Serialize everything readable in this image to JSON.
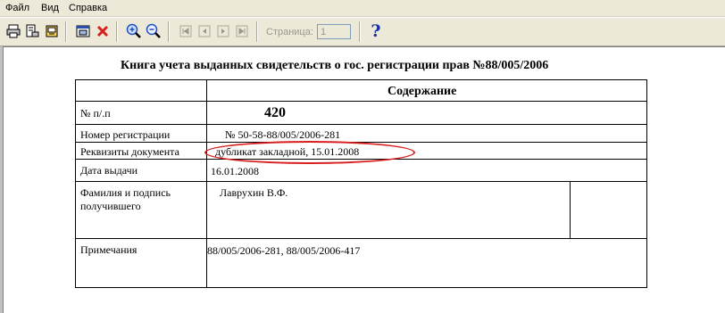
{
  "menu": {
    "file": "Файл",
    "view": "Вид",
    "help": "Справка"
  },
  "toolbar": {
    "icons": [
      "printer-icon",
      "page-setup-icon",
      "export-icon",
      "fit-page-icon",
      "close-icon",
      "zoom-in-icon",
      "zoom-out-icon",
      "first-page-icon",
      "prev-page-icon",
      "next-page-icon",
      "last-page-icon",
      "help-icon"
    ],
    "page_label": "Страница:",
    "page_value": "1",
    "help_glyph": "?"
  },
  "colors": {
    "accent_red": "#d81e1e",
    "help_blue": "#1a2fa6",
    "zoom_blue": "#1f4fbf"
  },
  "report": {
    "title": "Книга учета выданных свидетельств о гос. регистрации прав  №88/005/2006",
    "header": "Содержание",
    "rows": [
      {
        "label": "№ п/.п",
        "value": "420"
      },
      {
        "label": "Номер регистрации",
        "value": "№ 50-58-88/005/2006-281"
      },
      {
        "label": "Реквизиты документа",
        "value": "дубликат закладной,  15.01.2008"
      },
      {
        "label": "Дата выдачи",
        "value": "16.01.2008"
      },
      {
        "label": "Фамилия и подпись",
        "label2": "получившего",
        "value": "Лаврухин В.Ф."
      },
      {
        "label": "Примечания",
        "value": "88/005/2006-281, 88/005/2006-417"
      }
    ]
  }
}
